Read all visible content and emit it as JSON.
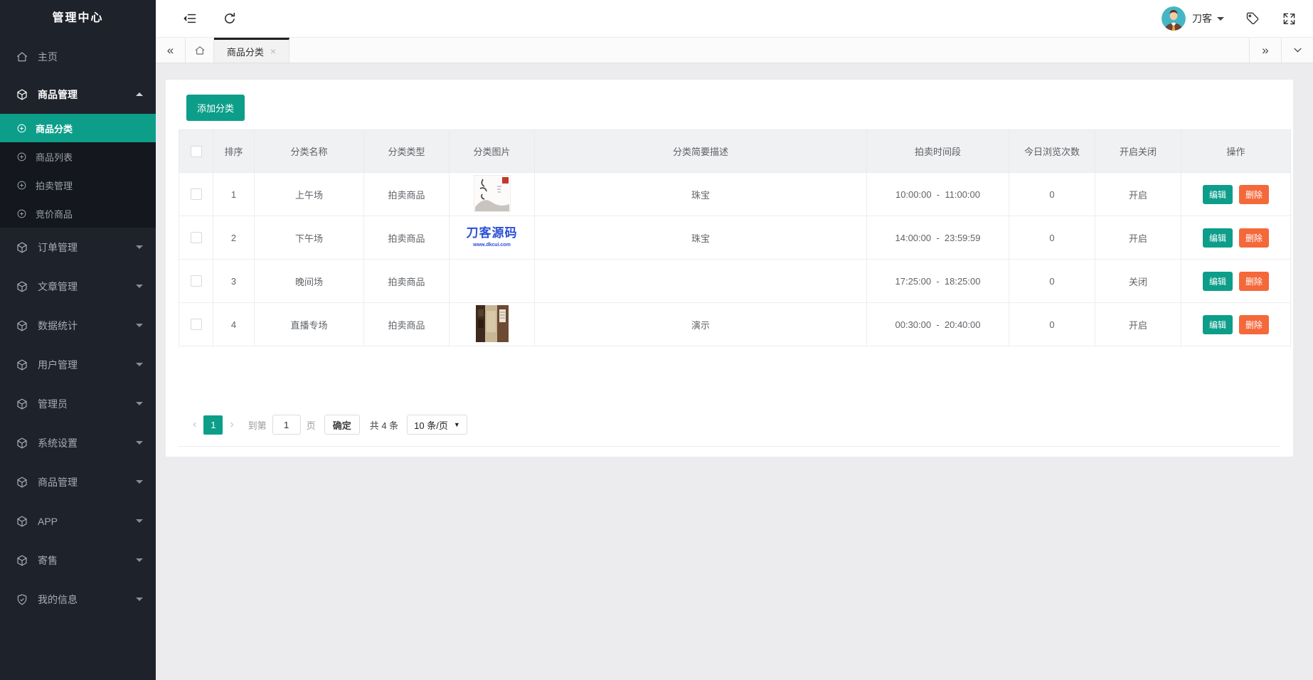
{
  "app": {
    "title": "管理中心"
  },
  "sidebar": {
    "home": {
      "label": "主页",
      "icon": "home-icon"
    },
    "parent": {
      "label": "商品管理",
      "icon": "cube-icon",
      "expanded": true
    },
    "submenu": [
      {
        "label": "商品分类",
        "active": true
      },
      {
        "label": "商品列表",
        "active": false
      },
      {
        "label": "拍卖管理",
        "active": false
      },
      {
        "label": "竞价商品",
        "active": false
      }
    ],
    "items": [
      {
        "label": "订单管理",
        "icon": "cube-icon"
      },
      {
        "label": "文章管理",
        "icon": "cube-icon"
      },
      {
        "label": "数据统计",
        "icon": "cube-icon"
      },
      {
        "label": "用户管理",
        "icon": "cube-icon"
      },
      {
        "label": "管理员",
        "icon": "cube-icon"
      },
      {
        "label": "系统设置",
        "icon": "cube-icon"
      },
      {
        "label": "商品管理",
        "icon": "cube-icon"
      },
      {
        "label": "APP",
        "icon": "cube-icon"
      },
      {
        "label": "寄售",
        "icon": "cube-icon"
      },
      {
        "label": "我的信息",
        "icon": "shield-icon"
      }
    ]
  },
  "topbar": {
    "username": "刀客"
  },
  "tabbar": {
    "active_tab": "商品分类",
    "close": "×"
  },
  "toolbar": {
    "add_button": "添加分类"
  },
  "table": {
    "headers": [
      "排序",
      "分类名称",
      "分类类型",
      "分类图片",
      "分类简要描述",
      "拍卖时间段",
      "今日浏览次数",
      "开启关闭",
      "操作"
    ],
    "edit_label": "编辑",
    "delete_label": "删除",
    "rows": [
      {
        "order": "1",
        "name": "上午场",
        "type": "拍卖商品",
        "image": {
          "kind": "ink-painting"
        },
        "desc": "珠宝",
        "time_start": "10:00:00",
        "time_end": "11:00:00",
        "views": "0",
        "status": "开启"
      },
      {
        "order": "2",
        "name": "下午场",
        "type": "拍卖商品",
        "image": {
          "kind": "logo",
          "text": "刀客源码",
          "subtext": "www.dkcui.com"
        },
        "desc": "珠宝",
        "time_start": "14:00:00",
        "time_end": "23:59:59",
        "views": "0",
        "status": "开启"
      },
      {
        "order": "3",
        "name": "晚间场",
        "type": "拍卖商品",
        "image": {
          "kind": "none"
        },
        "desc": "",
        "time_start": "17:25:00",
        "time_end": "18:25:00",
        "views": "0",
        "status": "关闭"
      },
      {
        "order": "4",
        "name": "直播专场",
        "type": "拍卖商品",
        "image": {
          "kind": "photo"
        },
        "desc": "演示",
        "time_start": "00:30:00",
        "time_end": "20:40:00",
        "views": "0",
        "status": "开启"
      }
    ]
  },
  "pagination": {
    "current": "1",
    "goto_label": "到第",
    "goto_value": "1",
    "page_label": "页",
    "confirm_label": "确定",
    "total_label": "共 4 条",
    "page_size": "10 条/页"
  },
  "colors": {
    "accent": "#0d9e8a",
    "danger": "#f4683a",
    "sidebar_bg": "#1e222b",
    "submenu_bg": "#14171d",
    "logo_blue": "#2b50d5",
    "tab_active_border": "#1f1f1f"
  }
}
